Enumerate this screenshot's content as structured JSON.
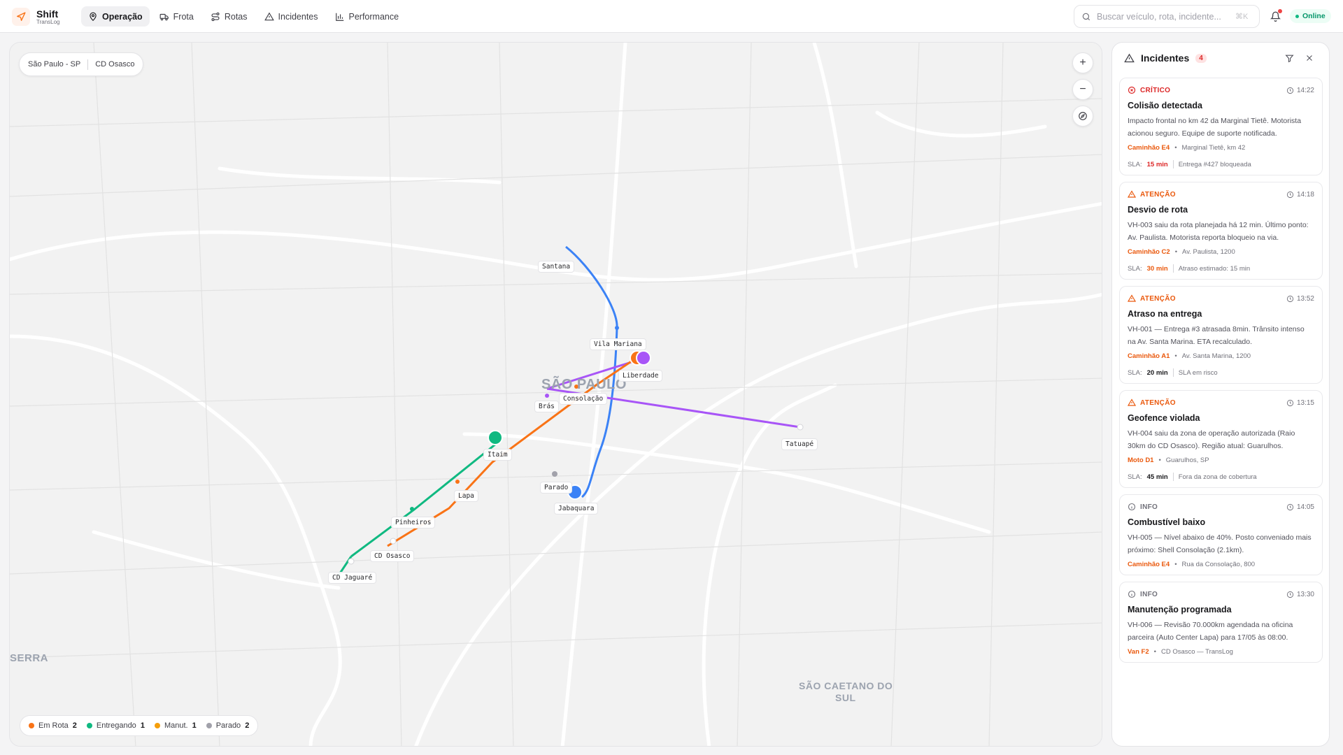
{
  "brand": {
    "name": "Shift",
    "sub": "TransLog"
  },
  "nav": [
    {
      "label": "Operação",
      "icon": "pin-icon",
      "active": true
    },
    {
      "label": "Frota",
      "icon": "truck-icon"
    },
    {
      "label": "Rotas",
      "icon": "route-icon"
    },
    {
      "label": "Incidentes",
      "icon": "warning-icon"
    },
    {
      "label": "Performance",
      "icon": "bar-chart-icon"
    }
  ],
  "search": {
    "placeholder": "Buscar veículo, rota, incidente...",
    "shortcut": "⌘K"
  },
  "status": {
    "label": "Online"
  },
  "map": {
    "breadcrumb": [
      "São Paulo - SP",
      "CD Osasco"
    ],
    "city_labels": [
      "SÃO PAULO",
      "SERRA",
      "SÃO CAETANO DO",
      "SUL"
    ],
    "stops": [
      "Santana",
      "Vila Mariana",
      "Liberdade",
      "Brás",
      "Consolação",
      "Tatuapé",
      "Itaim",
      "Parado",
      "Jabaquara",
      "Lapa",
      "Pinheiros",
      "CD Osasco",
      "CD Jaguaré"
    ],
    "colors": {
      "em_rota": "#f97316",
      "entregando": "#10b981",
      "manut": "#f59e0b",
      "parado": "#a1a1aa",
      "route_blue": "#3b82f6",
      "route_purple": "#a855f7"
    }
  },
  "legend": [
    {
      "label": "Em Rota",
      "count": "2",
      "color": "#f97316"
    },
    {
      "label": "Entregando",
      "count": "1",
      "color": "#10b981"
    },
    {
      "label": "Manut.",
      "count": "1",
      "color": "#f59e0b"
    },
    {
      "label": "Parado",
      "count": "2",
      "color": "#a1a1aa"
    }
  ],
  "incidents": {
    "title": "Incidentes",
    "count": "4",
    "items": [
      {
        "severity": "CRÍTICO",
        "sev_color": "#dc2626",
        "time": "14:22",
        "title": "Colisão detectada",
        "desc": "Impacto frontal no km 42 da Marginal Tietê. Motorista acionou seguro. Equipe de suporte notificada.",
        "vehicle": "Caminhão E4",
        "location": "Marginal Tietê, km 42",
        "sla_label": "SLA:",
        "sla": "15 min",
        "sla_color": "#dc2626",
        "sla_note": "Entrega #427 bloqueada"
      },
      {
        "severity": "ATENÇÃO",
        "sev_color": "#ea580c",
        "time": "14:18",
        "title": "Desvio de rota",
        "desc": "VH-003 saiu da rota planejada há 12 min. Último ponto: Av. Paulista. Motorista reporta bloqueio na via.",
        "vehicle": "Caminhão C2",
        "location": "Av. Paulista, 1200",
        "sla_label": "SLA:",
        "sla": "30 min",
        "sla_color": "#ea580c",
        "sla_note": "Atraso estimado: 15 min"
      },
      {
        "severity": "ATENÇÃO",
        "sev_color": "#ea580c",
        "time": "13:52",
        "title": "Atraso na entrega",
        "desc": "VH-001 — Entrega #3 atrasada 8min. Trânsito intenso na Av. Santa Marina. ETA recalculado.",
        "vehicle": "Caminhão A1",
        "location": "Av. Santa Marina, 1200",
        "sla_label": "SLA:",
        "sla": "20 min",
        "sla_color": "#18181b",
        "sla_note": "SLA em risco"
      },
      {
        "severity": "ATENÇÃO",
        "sev_color": "#ea580c",
        "time": "13:15",
        "title": "Geofence violada",
        "desc": "VH-004 saiu da zona de operação autorizada (Raio 30km do CD Osasco). Região atual: Guarulhos.",
        "vehicle": "Moto D1",
        "location": "Guarulhos, SP",
        "sla_label": "SLA:",
        "sla": "45 min",
        "sla_color": "#18181b",
        "sla_note": "Fora da zona de cobertura"
      },
      {
        "severity": "INFO",
        "sev_color": "#71717a",
        "time": "14:05",
        "title": "Combustível baixo",
        "desc": "VH-005 — Nível abaixo de 40%. Posto conveniado mais próximo: Shell Consolação (2.1km).",
        "vehicle": "Caminhão E4",
        "location": "Rua da Consolação, 800"
      },
      {
        "severity": "INFO",
        "sev_color": "#71717a",
        "time": "13:30",
        "title": "Manutenção programada",
        "desc": "VH-006 — Revisão 70.000km agendada na oficina parceira (Auto Center Lapa) para 17/05 às 08:00.",
        "vehicle": "Van F2",
        "location": "CD Osasco — TransLog"
      }
    ]
  }
}
